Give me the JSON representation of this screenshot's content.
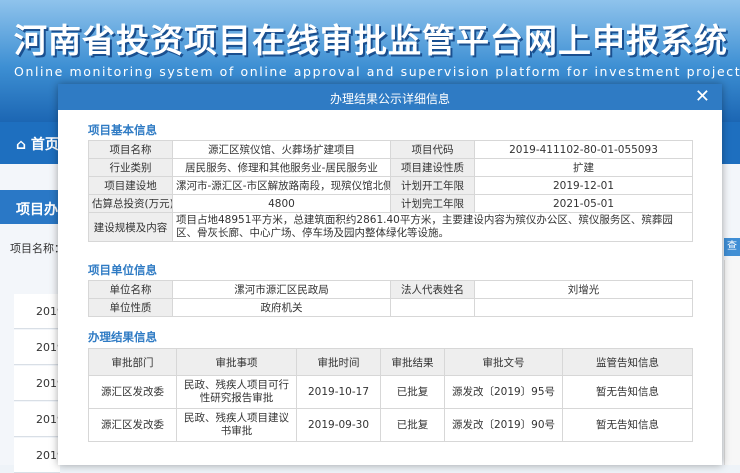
{
  "background": {
    "site_title": "河南省投资项目在线审批监管平台网上申报系统",
    "site_subtitle": "Online monitoring system of online approval and supervision platform for investment projects in Henan",
    "nav_home": "首页",
    "section_label": "项目办理",
    "field_label": "项目名称：",
    "row_year": "2019",
    "right_button": "查"
  },
  "modal": {
    "title": "办理结果公示详细信息",
    "close_icon": "close-icon",
    "basic_info": {
      "section_title": "项目基本信息",
      "rows": {
        "name_label": "项目名称",
        "name": "源汇区殡仪馆、火葬场扩建项目",
        "code_label": "项目代码",
        "code": "2019-411102-80-01-055093",
        "industry_label": "行业类别",
        "industry": "居民服务、修理和其他服务业-居民服务业",
        "nature_label": "项目建设性质",
        "nature": "扩建",
        "location_label": "项目建设地",
        "location": "漯河市-源汇区-市区解放路南段，现殡仪馆北侧",
        "start_label": "计划开工年限",
        "start": "2019-12-01",
        "investment_label": "估算总投资(万元)",
        "investment": "4800",
        "end_label": "计划完工年限",
        "end": "2021-05-01",
        "scale_label": "建设规模及内容",
        "scale": "项目占地48951平方米，总建筑面积约2861.40平方米，主要建设内容为殡仪办公区、殡仪服务区、殡葬园区、骨灰长廊、中心广场、停车场及园内整体绿化等设施。"
      }
    },
    "unit_info": {
      "section_title": "项目单位信息",
      "unit_name_label": "单位名称",
      "unit_name": "漯河市源汇区民政局",
      "legal_rep_label": "法人代表姓名",
      "legal_rep": "刘增光",
      "unit_nature_label": "单位性质",
      "unit_nature": "政府机关"
    },
    "result_info": {
      "section_title": "办理结果信息",
      "headers": [
        "审批部门",
        "审批事项",
        "审批时间",
        "审批结果",
        "审批文号",
        "监管告知信息"
      ],
      "rows": [
        {
          "dept": "源汇区发改委",
          "item": "民政、残疾人项目可行性研究报告审批",
          "date": "2019-10-17",
          "result": "已批复",
          "doc_no": "源发改〔2019〕95号",
          "notice": "暂无告知信息"
        },
        {
          "dept": "源汇区发改委",
          "item": "民政、残疾人项目建议书审批",
          "date": "2019-09-30",
          "result": "已批复",
          "doc_no": "源发改〔2019〕90号",
          "notice": "暂无告知信息"
        }
      ]
    }
  }
}
